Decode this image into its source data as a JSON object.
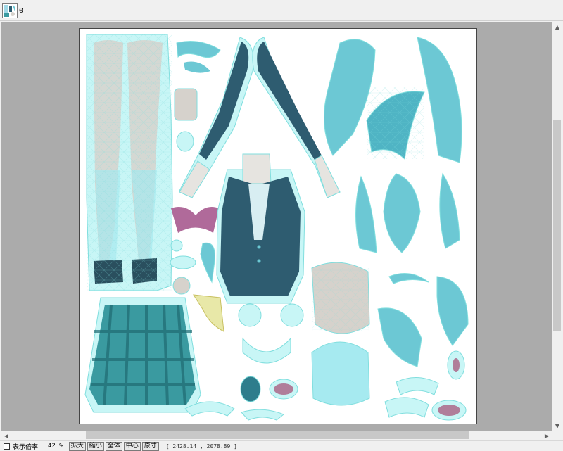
{
  "tab": {
    "label": "0"
  },
  "status": {
    "zoom_label": "表示倍率",
    "zoom_value": "42 %",
    "buttons": [
      "拡大",
      "縮小",
      "全体",
      "中心",
      "原寸"
    ],
    "coords": "[ 2428.14 , 2078.89 ]"
  },
  "colors": {
    "uv_fill": "#c8f6f6",
    "uv_edge": "#80dede",
    "hair": "#6cc8d4",
    "uniform": "#2e5c70",
    "skin": "#d6d2cc",
    "skirt": "#3a9aa0",
    "bow": "#b06a9a"
  }
}
